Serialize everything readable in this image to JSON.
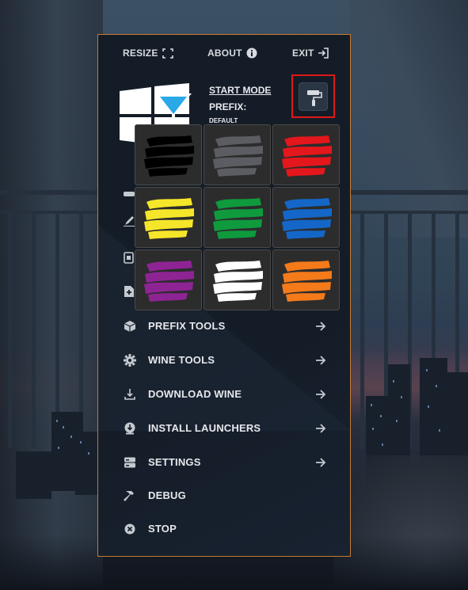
{
  "header": {
    "resize_label": "RESIZE",
    "about_label": "ABOUT",
    "exit_label": "EXIT"
  },
  "status": {
    "start_mode_label": "START MODE",
    "prefix_label": "PREFIX:",
    "prefix_value": "DEFAULT"
  },
  "color_picker": {
    "swatches": [
      {
        "name": "black",
        "color": "#000000"
      },
      {
        "name": "gray",
        "color": "#5b5d63"
      },
      {
        "name": "red",
        "color": "#e3171c"
      },
      {
        "name": "yellow",
        "color": "#f6e62a"
      },
      {
        "name": "green",
        "color": "#0f9a3e"
      },
      {
        "name": "blue",
        "color": "#1467c8"
      },
      {
        "name": "purple",
        "color": "#8e2494"
      },
      {
        "name": "white",
        "color": "#ffffff"
      },
      {
        "name": "orange",
        "color": "#f47a1a"
      }
    ]
  },
  "menu": {
    "items": [
      {
        "label": "PREFIX TOOLS",
        "icon": "cube-icon",
        "arrow": true
      },
      {
        "label": "WINE TOOLS",
        "icon": "gear-icon",
        "arrow": true
      },
      {
        "label": "DOWNLOAD WINE",
        "icon": "download-icon",
        "arrow": true
      },
      {
        "label": "INSTALL LAUNCHERS",
        "icon": "install-icon",
        "arrow": true
      },
      {
        "label": "SETTINGS",
        "icon": "server-icon",
        "arrow": true
      },
      {
        "label": "DEBUG",
        "icon": "hammer-icon",
        "arrow": false
      },
      {
        "label": "STOP",
        "icon": "stop-icon",
        "arrow": false
      }
    ]
  },
  "colors": {
    "accent_border": "#c77a2d",
    "highlight": "#e01818"
  }
}
